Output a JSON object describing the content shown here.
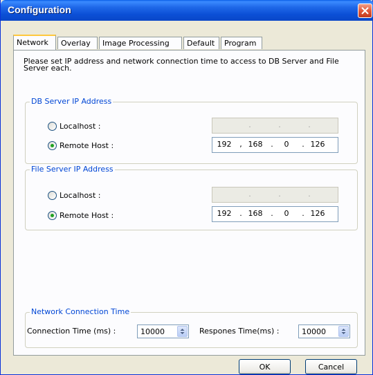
{
  "window": {
    "title": "Configuration"
  },
  "tabs": [
    {
      "label": "Network"
    },
    {
      "label": "Overlay"
    },
    {
      "label": "Image Processing"
    },
    {
      "label": "Default"
    },
    {
      "label": "Program"
    }
  ],
  "active_tab": "Network",
  "intro": "Please set IP address and network connection time to access to DB Server and File Server each.",
  "db_server": {
    "legend": "DB Server IP Address",
    "localhost_label": "Localhost :",
    "remote_label": "Remote Host :",
    "selected": "remote",
    "localhost_ip": [
      ".",
      ".",
      "."
    ],
    "remote_ip": [
      "192",
      "168",
      "0",
      "126"
    ]
  },
  "file_server": {
    "legend": "File Server IP Address",
    "localhost_label": "Localhost :",
    "remote_label": "Remote Host :",
    "selected": "remote",
    "localhost_ip": [
      ".",
      ".",
      "."
    ],
    "remote_ip": [
      "192",
      "168",
      "0",
      "126"
    ]
  },
  "network_time": {
    "legend": "Network Connection Time",
    "connection_label": "Connection Time (ms) :",
    "connection_value": "10000",
    "response_label": "Respones Time(ms) :",
    "response_value": "10000"
  },
  "buttons": {
    "ok": "OK",
    "cancel": "Cancel"
  },
  "colors": {
    "title_bar": "#0b4fd6",
    "legend_text": "#0046d5",
    "radio_selected": "#21a121"
  }
}
